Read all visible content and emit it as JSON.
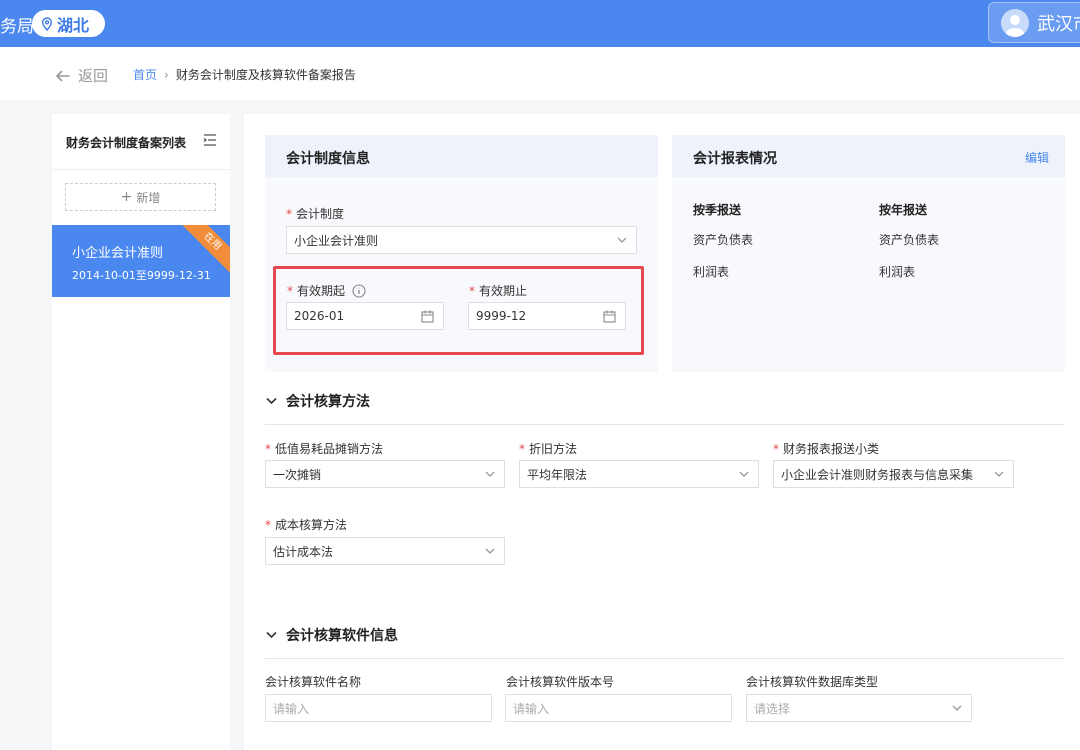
{
  "header": {
    "org_fragment": "务局",
    "region": "湖北",
    "user_name": "武汉市"
  },
  "breadcrumb": {
    "back_label": "返回",
    "home": "首页",
    "separator": "›",
    "current": "财务会计制度及核算软件备案报告"
  },
  "sidebar": {
    "title": "财务会计制度备案列表",
    "add_label": "新增",
    "items": [
      {
        "name": "小企业会计准则",
        "date_range": "2014-10-01至9999-12-31",
        "badge": "在用",
        "selected": true
      }
    ]
  },
  "accounting_system": {
    "title": "会计制度信息",
    "system_label": "会计制度",
    "system_value": "小企业会计准则",
    "start_label": "有效期起",
    "start_value": "2026-01",
    "end_label": "有效期止",
    "end_value": "9999-12"
  },
  "report_status": {
    "title": "会计报表情况",
    "edit_label": "编辑",
    "columns": [
      {
        "head": "按季报送",
        "items": [
          "资产负债表",
          "利润表"
        ]
      },
      {
        "head": "按年报送",
        "items": [
          "资产负债表",
          "利润表"
        ]
      }
    ]
  },
  "methods": {
    "title": "会计核算方法",
    "low_value_label": "低值易耗品摊销方法",
    "low_value_value": "一次摊销",
    "depreciation_label": "折旧方法",
    "depreciation_value": "平均年限法",
    "report_subclass_label": "财务报表报送小类",
    "report_subclass_value": "小企业会计准则财务报表与信息采集",
    "cost_label": "成本核算方法",
    "cost_value": "估计成本法"
  },
  "software": {
    "title": "会计核算软件信息",
    "name_label": "会计核算软件名称",
    "name_placeholder": "请输入",
    "version_label": "会计核算软件版本号",
    "version_placeholder": "请输入",
    "db_label": "会计核算软件数据库类型",
    "db_placeholder": "请选择"
  },
  "colors": {
    "primary": "#4a87ee",
    "required": "#e5484d",
    "badge": "#f08c3a",
    "highlight_box": "#e5484d"
  },
  "icons": [
    "location-pin-icon",
    "user-avatar-icon",
    "arrow-left-icon",
    "collapse-menu-icon",
    "plus-icon",
    "chevron-down-icon",
    "calendar-icon",
    "info-icon"
  ]
}
